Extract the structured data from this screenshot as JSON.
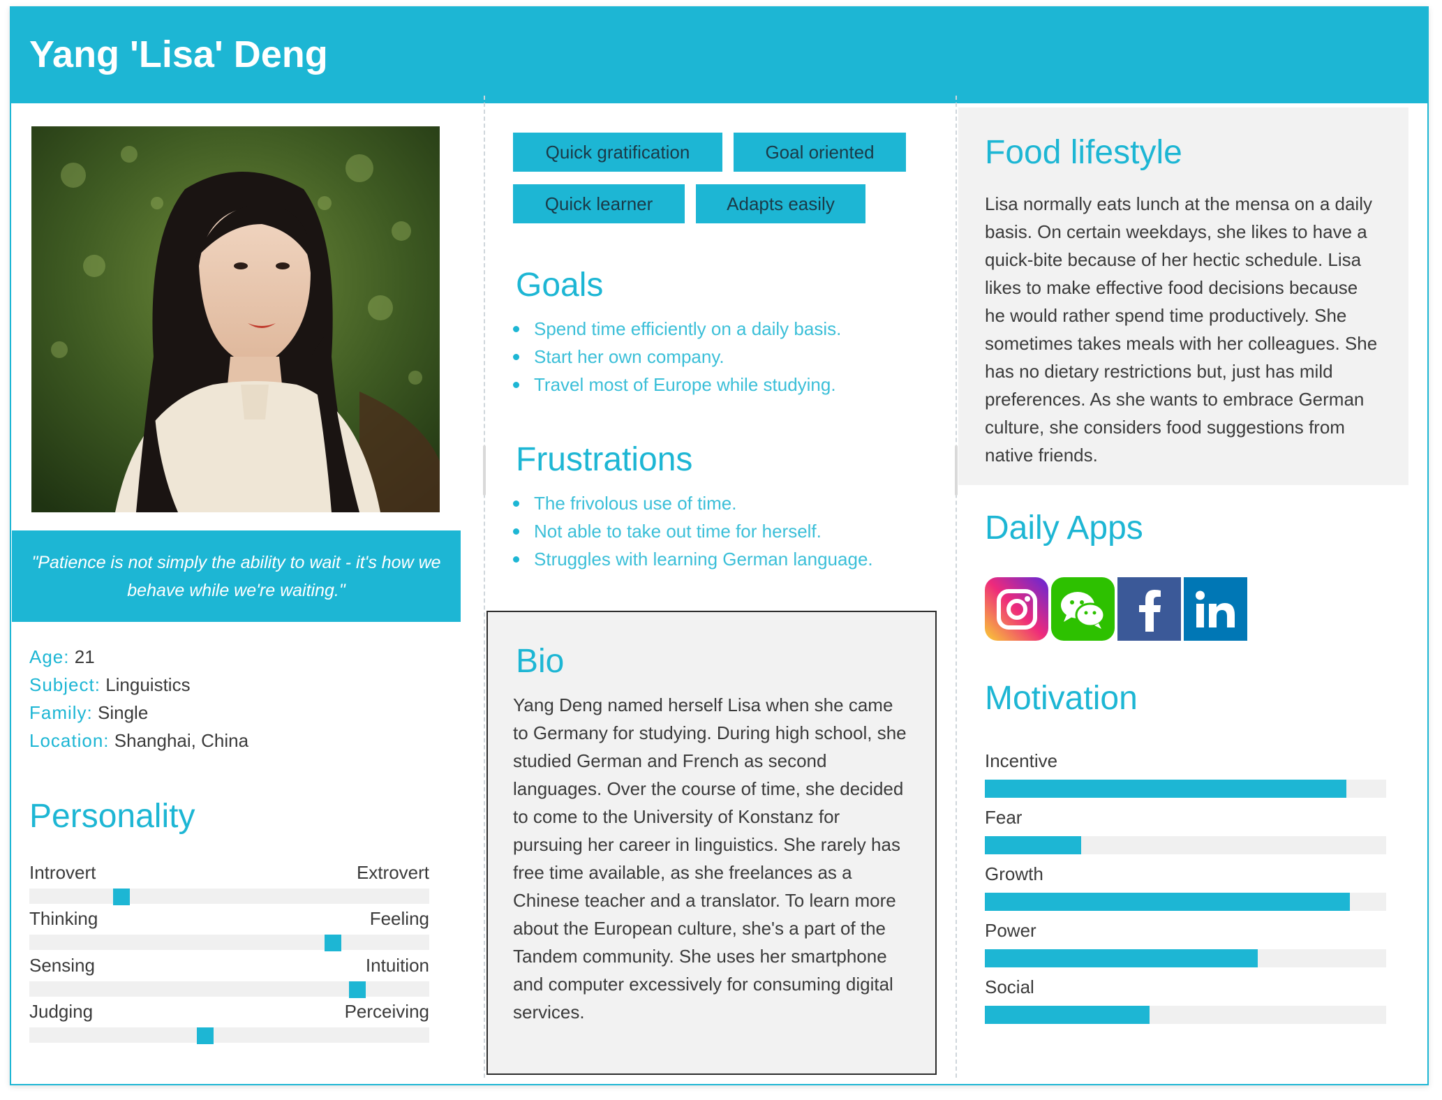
{
  "persona": {
    "name": "Yang 'Lisa' Deng"
  },
  "quote": "\"Patience is not simply the ability to wait - it's how we behave while we're waiting.\"",
  "facts": [
    {
      "key": "Age:",
      "value": "21"
    },
    {
      "key": "Subject:",
      "value": "Linguistics"
    },
    {
      "key": "Family:",
      "value": "Single"
    },
    {
      "key": "Location:",
      "value": "Shanghai, China"
    }
  ],
  "personality": {
    "title": "Personality",
    "traits": [
      {
        "left": "Introvert",
        "right": "Extrovert",
        "value": 0.23
      },
      {
        "left": "Thinking",
        "right": "Feeling",
        "value": 0.76
      },
      {
        "left": "Sensing",
        "right": "Intuition",
        "value": 0.82
      },
      {
        "left": "Judging",
        "right": "Perceiving",
        "value": 0.44
      }
    ]
  },
  "tags": [
    "Quick gratification",
    "Goal oriented",
    "Quick learner",
    "Adapts easily"
  ],
  "goals": {
    "title": "Goals",
    "items": [
      "Spend time efficiently on a daily basis.",
      "Start her own company.",
      "Travel most of Europe while studying."
    ]
  },
  "frustrations": {
    "title": "Frustrations",
    "items": [
      "The frivolous use of time.",
      "Not able to take out time for herself.",
      "Struggles with learning German language."
    ]
  },
  "bio": {
    "title": "Bio",
    "lines": [
      "Yang Deng named herself Lisa when she came",
      "to Germany for studying. During high school, she",
      "studied German and French as second",
      "languages. Over the course of time, she decided",
      "to come to the University of Konstanz for",
      "pursuing her career in linguistics. She rarely has",
      "free time available, as she freelances as a",
      "Chinese teacher and a translator. To learn more",
      "about the European culture, she's a part of the",
      "Tandem community. She uses her smartphone",
      "and computer excessively for consuming digital",
      "services."
    ]
  },
  "food": {
    "title": "Food lifestyle",
    "lines": [
      "Lisa normally eats lunch at the mensa on a daily",
      "basis. On certain weekdays, she likes to have a",
      "quick-bite because of her hectic schedule. Lisa",
      "likes to make effective food decisions because",
      "he would rather spend time productively. She",
      "sometimes takes meals with her colleagues. She",
      "has no dietary restrictions but, just has mild",
      "preferences. As she wants to embrace German",
      "culture, she considers food suggestions from",
      "native friends."
    ]
  },
  "apps": {
    "title": "Daily Apps",
    "items": [
      {
        "name": "instagram-icon",
        "color": "#c13584"
      },
      {
        "name": "wechat-icon",
        "color": "#2dc100"
      },
      {
        "name": "facebook-icon",
        "color": "#3b5998"
      },
      {
        "name": "linkedin-icon",
        "color": "#0077b5"
      }
    ]
  },
  "motivation": {
    "title": "Motivation",
    "items": [
      {
        "label": "Incentive",
        "value": 0.9
      },
      {
        "label": "Fear",
        "value": 0.24
      },
      {
        "label": "Growth",
        "value": 0.91
      },
      {
        "label": "Power",
        "value": 0.68
      },
      {
        "label": "Social",
        "value": 0.41
      }
    ]
  },
  "colors": {
    "accent": "#1db6d4",
    "panel": "#f2f2f2",
    "track": "#f0f0f0"
  }
}
